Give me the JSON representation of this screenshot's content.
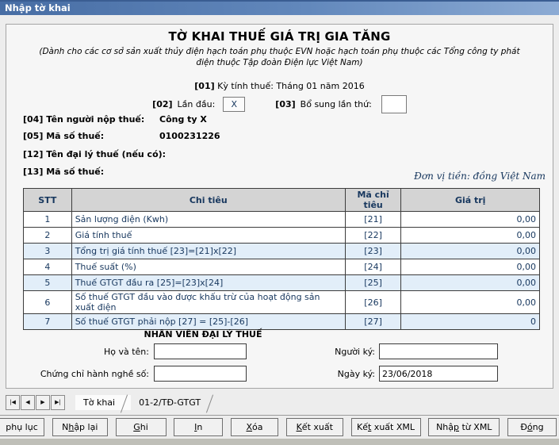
{
  "window": {
    "title": "Nhập tờ khai"
  },
  "form": {
    "title": "TỜ KHAI THUẾ GIÁ TRỊ GIA TĂNG",
    "subtitle": "(Dành cho các cơ sở sản xuất thủy điện hạch toán phụ thuộc EVN hoặc hạch toán phụ thuộc các Tổng công ty phát điện thuộc Tập đoàn Điện lực Việt Nam)",
    "period": {
      "code": "[01]",
      "label": "Kỳ tính thuế:",
      "value": "Tháng 01 năm 2016"
    },
    "first_time": {
      "code": "[02]",
      "label": "Lần đầu:",
      "value": "X"
    },
    "supplement": {
      "code": "[03]",
      "label": "Bổ sung lần thứ:",
      "value": ""
    },
    "taxpayer": {
      "code": "[04]",
      "label": "Tên người nộp thuế:",
      "value": "Công ty X"
    },
    "tax_id": {
      "code": "[05]",
      "label": "Mã số thuế:",
      "value": "0100231226"
    },
    "agent_name": {
      "code": "[12]",
      "label": "Tên đại lý thuế (nếu có):",
      "value": ""
    },
    "agent_tax_id": {
      "code": "[13]",
      "label": "Mã số thuế:",
      "value": ""
    },
    "currency_note": "Đơn vị tiền: đồng Việt Nam"
  },
  "table": {
    "headers": [
      "STT",
      "Chi tiêu",
      "Mã chỉ tiêu",
      "Giá trị"
    ],
    "rows": [
      {
        "stt": "1",
        "name": "Sản lượng điện (Kwh)",
        "code": "[21]",
        "value": "0,00",
        "highlight": false
      },
      {
        "stt": "2",
        "name": "Giá tính thuế",
        "code": "[22]",
        "value": "0,00",
        "highlight": false
      },
      {
        "stt": "3",
        "name": "Tổng trị giá tính thuế [23]=[21]x[22]",
        "code": "[23]",
        "value": "0,00",
        "highlight": true
      },
      {
        "stt": "4",
        "name": "Thuế suất (%)",
        "code": "[24]",
        "value": "0,00",
        "highlight": false
      },
      {
        "stt": "5",
        "name": "Thuế GTGT đầu ra [25]=[23]x[24]",
        "code": "[25]",
        "value": "0,00",
        "highlight": true
      },
      {
        "stt": "6",
        "name": "Số thuế GTGT đầu vào được khấu trừ của hoạt động sản xuất điện",
        "code": "[26]",
        "value": "0,00",
        "highlight": false
      },
      {
        "stt": "7",
        "name": "Số thuế GTGT phải nộp [27] = [25]-[26]",
        "code": "[27]",
        "value": "0",
        "highlight": true
      }
    ]
  },
  "agent_section": {
    "title": "NHÂN VIÊN ĐẠI LÝ THUẾ",
    "fields": {
      "full_name": {
        "label": "Họ và tên:",
        "value": ""
      },
      "cert_no": {
        "label": "Chứng chỉ hành nghề số:",
        "value": ""
      },
      "signer": {
        "label": "Người ký:",
        "value": ""
      },
      "sign_date": {
        "label": "Ngày ký:",
        "value": "23/06/2018"
      }
    }
  },
  "tabs": {
    "nav": [
      "|◀",
      "◀",
      "▶",
      "▶|"
    ],
    "items": [
      {
        "label": "Tờ khai",
        "active": true
      },
      {
        "label": "01-2/TĐ-GTGT",
        "active": false
      }
    ]
  },
  "toolbar": {
    "buttons": [
      {
        "pre": "phụ lục",
        "key": "",
        "post": ""
      },
      {
        "pre": "N",
        "key": "h",
        "post": "ập lại"
      },
      {
        "pre": "",
        "key": "G",
        "post": "hi"
      },
      {
        "pre": "",
        "key": "I",
        "post": "n"
      },
      {
        "pre": "",
        "key": "X",
        "post": "óa"
      },
      {
        "pre": "",
        "key": "K",
        "post": "ết xuất"
      },
      {
        "pre": "Kế",
        "key": "t",
        "post": " xuất XML"
      },
      {
        "pre": "Nhậ",
        "key": "p",
        "post": " từ XML"
      },
      {
        "pre": "Đ",
        "key": "ó",
        "post": "ng"
      }
    ]
  }
}
